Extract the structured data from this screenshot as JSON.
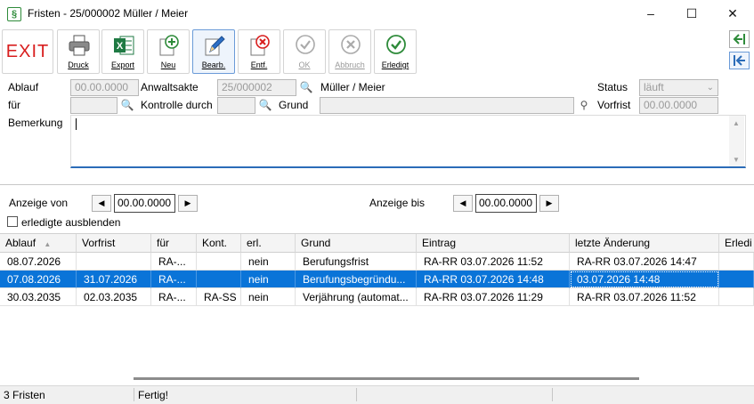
{
  "window": {
    "title": "Fristen - 25/000002 Müller / Meier",
    "app_icon_glyph": "§"
  },
  "toolbar": {
    "exit_label": "EXIT",
    "buttons": [
      {
        "label": "Druck",
        "icon": "printer-icon"
      },
      {
        "label": "Export",
        "icon": "excel-icon"
      },
      {
        "label": "Neu",
        "icon": "add-icon"
      },
      {
        "label": "Bearb.",
        "icon": "edit-pencil-icon"
      },
      {
        "label": "Entf.",
        "icon": "delete-icon"
      },
      {
        "label": "OK",
        "icon": "checkmark-icon"
      },
      {
        "label": "Abbruch",
        "icon": "cancel-icon"
      },
      {
        "label": "Erledigt",
        "icon": "done-icon"
      }
    ]
  },
  "form": {
    "ablauf_label": "Ablauf",
    "ablauf_value": "00.00.0000",
    "anwaltsakte_label": "Anwaltsakte",
    "anwaltsakte_value": "25/000002",
    "akte_name": "Müller / Meier",
    "status_label": "Status",
    "status_value": "läuft",
    "fuer_label": "für",
    "fuer_value": "",
    "kontrolle_label": "Kontrolle durch",
    "kontrolle_value": "",
    "grund_label": "Grund",
    "grund_value": "",
    "vorfrist_label": "Vorfrist",
    "vorfrist_value": "00.00.0000",
    "bemerkung_label": "Bemerkung",
    "bemerkung_value": ""
  },
  "filter": {
    "von_label": "Anzeige von",
    "von_value": "00.00.0000",
    "bis_label": "Anzeige bis",
    "bis_value": "00.00.0000",
    "hide_done_label": "erledigte ausblenden",
    "hide_done_checked": false
  },
  "grid": {
    "columns": [
      "Ablauf",
      "Vorfrist",
      "für",
      "Kont.",
      "erl.",
      "Grund",
      "Eintrag",
      "letzte Änderung",
      "Erledi"
    ],
    "sort_indicator": "▲",
    "rows": [
      {
        "ablauf": "08.07.2026",
        "vorfrist": "",
        "fuer": "RA-...",
        "kont": "",
        "erl": "nein",
        "grund": "Berufungsfrist",
        "eintrag": "RA-RR 03.07.2026  11:52",
        "aenderung": "RA-RR 03.07.2026  14:47",
        "erledigt": "",
        "selected": false
      },
      {
        "ablauf": "07.08.2026",
        "vorfrist": "31.07.2026",
        "fuer": "RA-...",
        "kont": "",
        "erl": "nein",
        "grund": "Berufungsbegründu...",
        "eintrag": "RA-RR 03.07.2026  14:48",
        "aenderung": "03.07.2026  14:48",
        "erledigt": "",
        "selected": true
      },
      {
        "ablauf": "30.03.2035",
        "vorfrist": "02.03.2035",
        "fuer": "RA-...",
        "kont": "RA-SS",
        "erl": "nein",
        "grund": "Verjährung (automat...",
        "eintrag": "RA-RR 03.07.2026  11:29",
        "aenderung": "RA-RR 03.07.2026  11:52",
        "erledigt": "",
        "selected": false
      }
    ]
  },
  "status": {
    "count": "3 Fristen",
    "message": "Fertig!"
  },
  "colors": {
    "selection": "#0a74d8",
    "focus_underline": "#2b6cb8",
    "exit_red": "#d81e1e"
  }
}
